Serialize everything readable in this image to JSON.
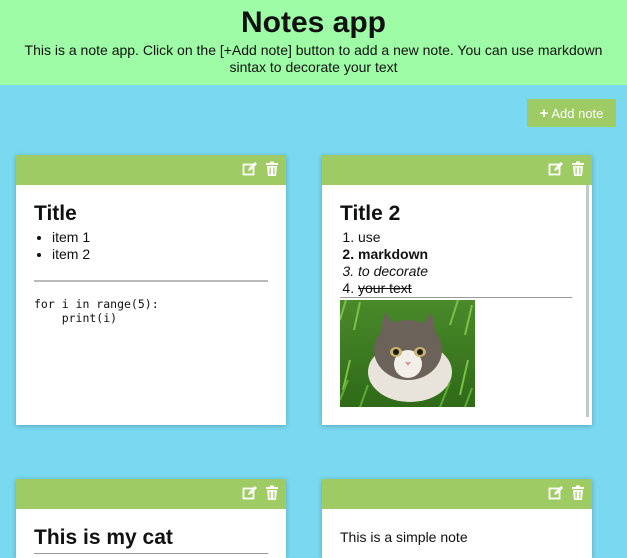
{
  "header": {
    "title": "Notes app",
    "description": "This is a note app. Click on the [+Add note] button to add a new note. You can use markdown sintax to decorate your text"
  },
  "add_button": {
    "label": "Add note"
  },
  "notes": [
    {
      "title": "Title",
      "list": [
        "item 1",
        "item 2"
      ],
      "code": "for i in range(5):\n    print(i)"
    },
    {
      "title": "Title 2",
      "list": [
        "use",
        "markdown",
        "to decorate",
        "your text"
      ]
    },
    {
      "title": "This is my cat"
    },
    {
      "text": "This is a simple note"
    }
  ],
  "icons": {
    "edit": "edit-icon",
    "delete": "trash-icon"
  },
  "colors": {
    "background": "#7ad9f0",
    "header": "#9dfca5",
    "accent": "#9ecb64"
  }
}
